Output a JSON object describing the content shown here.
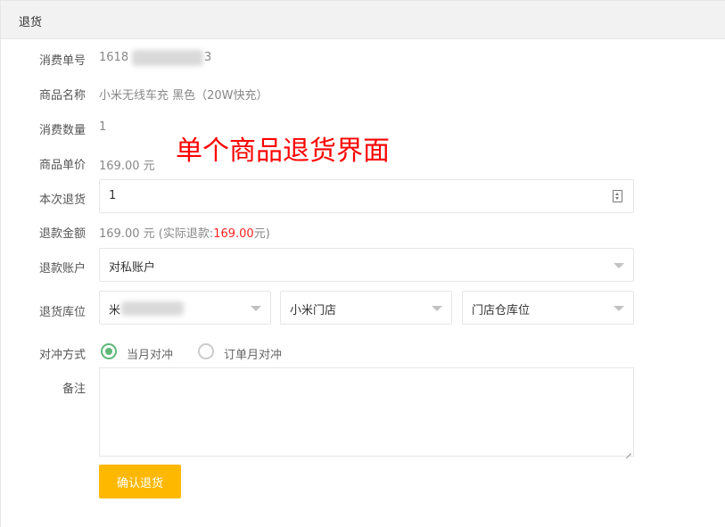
{
  "panel": {
    "title": "退货"
  },
  "fields": {
    "order_no": {
      "label": "消费单号",
      "value_visible_prefix": "1618",
      "value_visible_suffix": "3"
    },
    "product_name": {
      "label": "商品名称",
      "value": "小米无线车充 黑色（20W快充）"
    },
    "quantity": {
      "label": "消费数量",
      "value": "1"
    },
    "unit_price": {
      "label": "商品单价",
      "value": "169.00 元"
    },
    "return_qty": {
      "label": "本次退货",
      "value": "1"
    },
    "refund_amount": {
      "label": "退款金额",
      "value_prefix": "169.00 元 (实际退款:",
      "actual": "169.00",
      "value_suffix": "元)"
    },
    "refund_account": {
      "label": "退款账户",
      "selected": "对私账户"
    },
    "warehouse": {
      "label": "退货库位",
      "select1_visible_prefix": "米",
      "select1_visible_suffix": "",
      "select2": "小米门店",
      "select3": "门店仓库位"
    },
    "offset_method": {
      "label": "对冲方式",
      "options": [
        {
          "label": "当月对冲",
          "checked": true
        },
        {
          "label": "订单月对冲",
          "checked": false
        }
      ]
    },
    "remark": {
      "label": "备注",
      "value": ""
    }
  },
  "actions": {
    "confirm_label": "确认退货"
  },
  "annotation": {
    "text": "单个商品退货界面",
    "color": "#ff0000"
  },
  "colors": {
    "confirm_button": "#ffb800",
    "radio_checked": "#5fb878",
    "refund_actual": "#ff2222"
  }
}
